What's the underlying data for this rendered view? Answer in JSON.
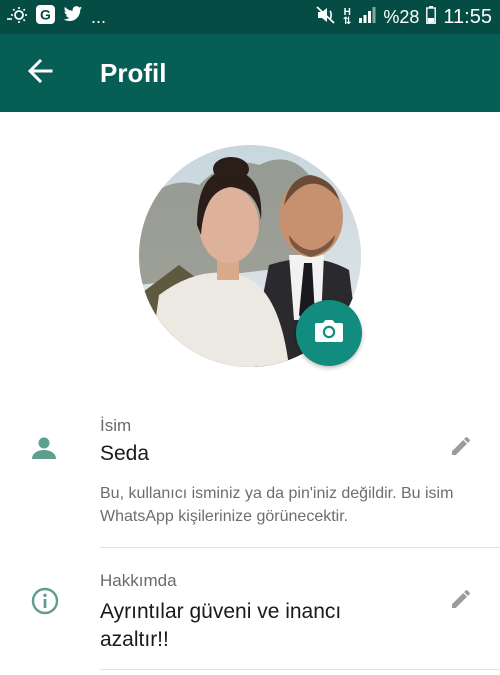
{
  "status_bar": {
    "icons": [
      "sun-icon",
      "google-icon",
      "twitter-icon",
      "more-dots",
      "mute-icon",
      "network-h-icon",
      "signal-icon",
      "battery-icon"
    ],
    "ellipsis": "...",
    "network_label": "H",
    "battery_text": "%28",
    "time": "11:55"
  },
  "toolbar": {
    "back_icon": "arrow-left-icon",
    "title": "Profil"
  },
  "profile": {
    "avatar": "profile-photo",
    "camera_icon": "camera-icon"
  },
  "name_section": {
    "icon": "person-icon",
    "label": "İsim",
    "value": "Seda",
    "hint": "Bu, kullanıcı isminiz ya da pin'iniz değildir. Bu isim WhatsApp kişilerinize görünecektir.",
    "edit_icon": "pencil-icon"
  },
  "about_section": {
    "icon": "info-icon",
    "label": "Hakkımda",
    "value": "Ayrıntılar güveni ve inancı azaltır!!",
    "edit_icon": "pencil-icon"
  },
  "colors": {
    "status_bar": "#054d44",
    "toolbar": "#075e54",
    "accent": "#128c7e"
  }
}
